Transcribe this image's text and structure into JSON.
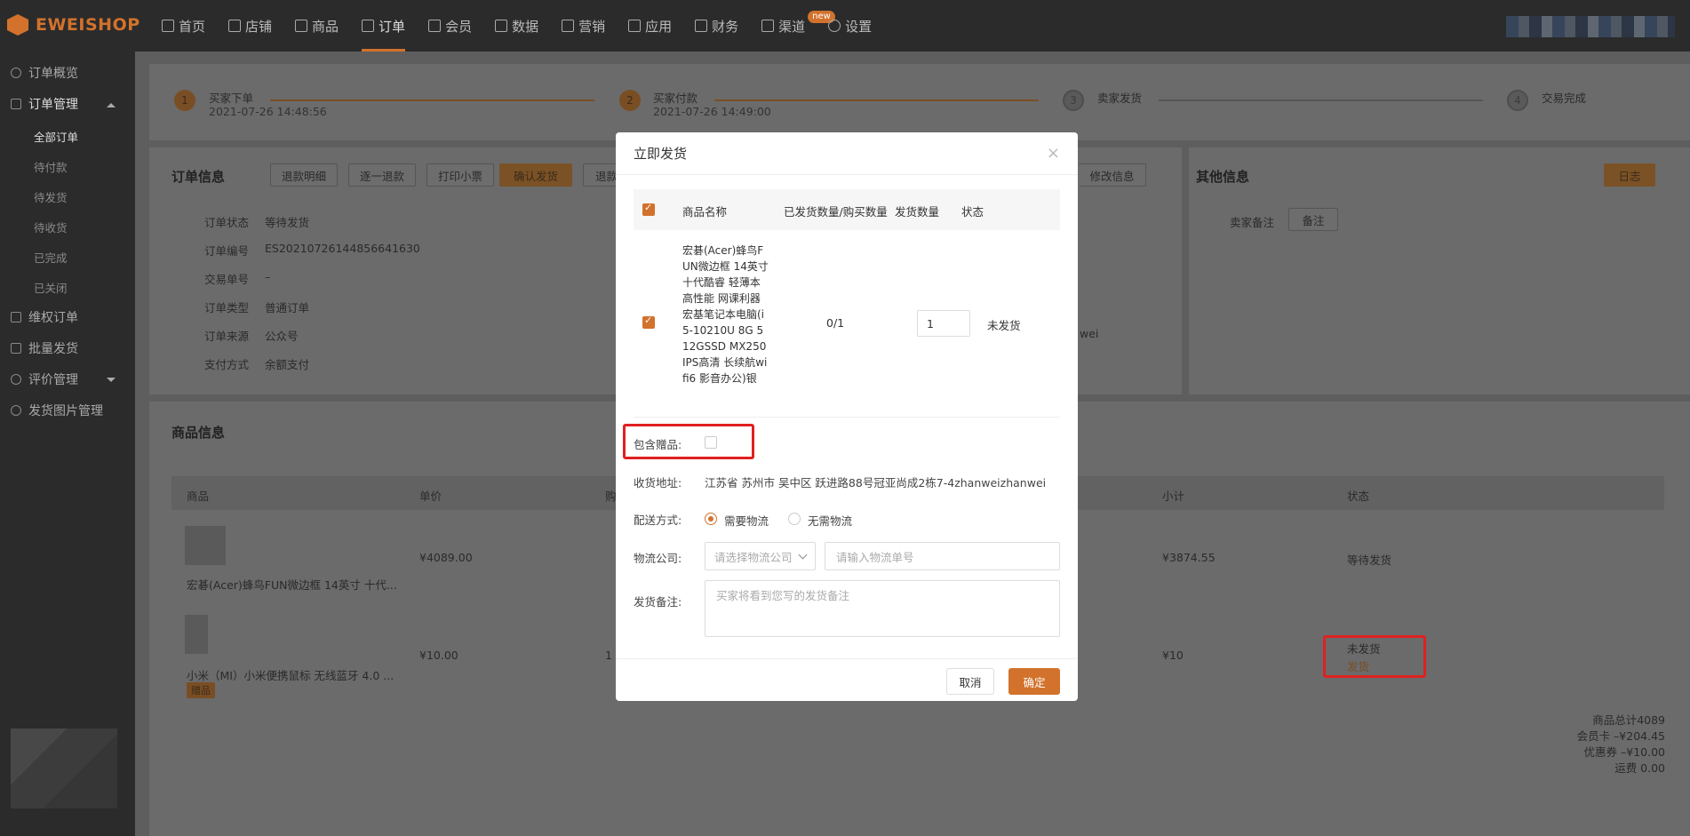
{
  "brand": {
    "name": "EWEISHOP"
  },
  "nav": [
    {
      "label": "首页",
      "icon": "home-icon"
    },
    {
      "label": "店铺",
      "icon": "shop-icon"
    },
    {
      "label": "商品",
      "icon": "goods-icon"
    },
    {
      "label": "订单",
      "icon": "order-icon",
      "active": true
    },
    {
      "label": "会员",
      "icon": "member-icon"
    },
    {
      "label": "数据",
      "icon": "data-icon"
    },
    {
      "label": "营销",
      "icon": "tag-icon"
    },
    {
      "label": "应用",
      "icon": "app-icon"
    },
    {
      "label": "财务",
      "icon": "finance-icon"
    },
    {
      "label": "渠道",
      "icon": "channel-icon",
      "badge": "new"
    },
    {
      "label": "设置",
      "icon": "settings-icon"
    }
  ],
  "sidebar": {
    "overview": "订单概览",
    "manage": "订单管理",
    "subs": [
      "全部订单",
      "待付款",
      "待发货",
      "待收货",
      "已完成",
      "已关闭"
    ],
    "rights": "维权订单",
    "batch": "批量发货",
    "review": "评价管理",
    "images": "发货图片管理"
  },
  "steps": [
    {
      "num": "1",
      "title": "买家下单",
      "time": "2021-07-26 14:48:56"
    },
    {
      "num": "2",
      "title": "买家付款",
      "time": "2021-07-26 14:49:00"
    },
    {
      "num": "3",
      "title": "卖家发货",
      "time": ""
    },
    {
      "num": "4",
      "title": "交易完成",
      "time": ""
    }
  ],
  "order_info": {
    "title": "订单信息",
    "buttons": [
      "退款明细",
      "逐一退款",
      "打印小票",
      "确认发货",
      "退款"
    ],
    "modify": "修改信息",
    "labels": [
      "订单状态",
      "订单编号",
      "交易单号",
      "订单类型",
      "订单来源",
      "支付方式"
    ],
    "values": [
      "等待发货",
      "ES20210726144856641630",
      "–",
      "普通订单",
      "公众号",
      "余额支付"
    ],
    "partial": "wei"
  },
  "other_info": {
    "title": "其他信息",
    "log_btn": "日志",
    "seller_note_label": "卖家备注",
    "note_btn": "备注"
  },
  "goods_info": {
    "title": "商品信息",
    "headers": [
      "商品",
      "单价",
      "购",
      "小计",
      "状态"
    ],
    "rows": [
      {
        "name": "宏碁(Acer)蜂鸟FUN微边框 14英寸 十代...",
        "price": "¥4089.00",
        "qty": "",
        "subtotal": "¥3874.55",
        "status": "等待发货",
        "status2": ""
      },
      {
        "name": "小米（MI）小米便携鼠标 无线蓝牙 4.0 ...",
        "price": "¥10.00",
        "qty": "1",
        "subtotal": "¥10",
        "status": "未发货",
        "status2": "发货",
        "tag": "赠品"
      }
    ],
    "summary": [
      "商品总计4089",
      "会员卡 –¥204.45",
      "优惠券 –¥10.00",
      "运费 0.00"
    ]
  },
  "modal": {
    "title": "立即发货",
    "headers": [
      "商品名称",
      "已发货数量/购买数量",
      "发货数量",
      "状态"
    ],
    "product": {
      "name": "宏碁(Acer)蜂鸟FUN微边框 14英寸十代酷睿 轻薄本高性能 网课利器 宏基笔记本电脑(i5-10210U 8G 512GSSD MX250 IPS高清 长续航wifi6 影音办公)银",
      "shipped": "0/1",
      "qty": "1",
      "status": "未发货"
    },
    "gift_label": "包含赠品:",
    "address_label": "收货地址:",
    "address": "江苏省 苏州市 吴中区 跃进路88号冠亚尚成2栋7-4zhanweizhanwei",
    "delivery_label": "配送方式:",
    "delivery_options": [
      "需要物流",
      "无需物流"
    ],
    "company_label": "物流公司:",
    "company_placeholder": "请选择物流公司",
    "tracking_placeholder": "请输入物流单号",
    "remark_label": "发货备注:",
    "remark_placeholder": "买家将看到您写的发货备注",
    "cancel": "取消",
    "confirm": "确定"
  },
  "colors": {
    "accent": "#d2722c",
    "highlight": "#e02020"
  }
}
